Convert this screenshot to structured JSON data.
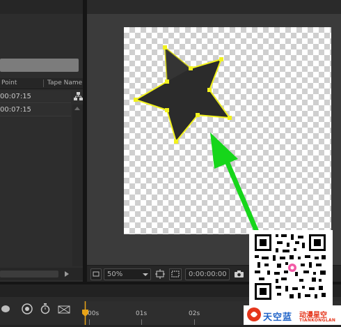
{
  "project_panel": {
    "columns": [
      "Point",
      "Tape Name"
    ],
    "rows": [
      {
        "time": "00:07:15"
      },
      {
        "time": "00:07:15"
      }
    ]
  },
  "viewer": {
    "toolbar": {
      "zoom": "50%",
      "timecode": "0:00:00:00"
    }
  },
  "timeline": {
    "ruler_labels": [
      "00s",
      "01s",
      "02s"
    ]
  },
  "watermark": {
    "brand_cn": "天空蓝",
    "brand_cn_right": "动漫星空",
    "brand_en": "TIANKONGLAN"
  },
  "colors": {
    "shape_fill": "#2b2b2b",
    "selection_stroke": "#f2f21d",
    "arrow_green": "#16d61a",
    "canvas_check": "#cfcfcf",
    "panel_bg": "#2d2d2d",
    "brand_blue": "#1f63c8",
    "brand_red": "#e5361b"
  },
  "icons": [
    "flowchart-icon",
    "zoom-dropdown-icon",
    "fit-frame-icon",
    "region-of-interest-icon",
    "snapshot-icon",
    "speaker-icon",
    "motion-blur-icon",
    "brush-icon",
    "stopwatch-icon",
    "frame-blending-icon",
    "current-time-indicator-icon",
    "qr-code-icon"
  ]
}
